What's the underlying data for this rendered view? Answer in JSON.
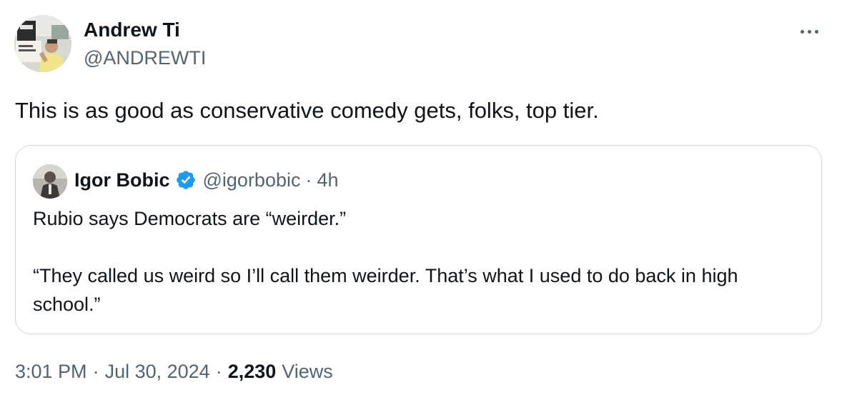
{
  "author": {
    "name": "Andrew Ti",
    "handle": "@ANDREWTI"
  },
  "tweet": {
    "text": "This is as good as conservative comedy gets, folks, top tier."
  },
  "quoted": {
    "name": "Igor Bobic",
    "handle": "@igorbobic",
    "separator": "·",
    "time": "4h",
    "verified": true,
    "paragraphs": [
      "Rubio says Democrats are “weirder.”",
      "“They called us weird so I’ll call them weirder. That’s what I used to do back in high school.”"
    ]
  },
  "footer": {
    "time": "3:01 PM",
    "date": "Jul 30, 2024",
    "separator": "·",
    "views_count": "2,230",
    "views_label": "Views"
  },
  "icons": {
    "more": "more-horizontal-icon",
    "verified": "verified-badge-icon"
  },
  "colors": {
    "text_primary": "#0f1419",
    "text_secondary": "#536471",
    "border": "#cfd9de",
    "verified_blue": "#1d9bf0"
  }
}
